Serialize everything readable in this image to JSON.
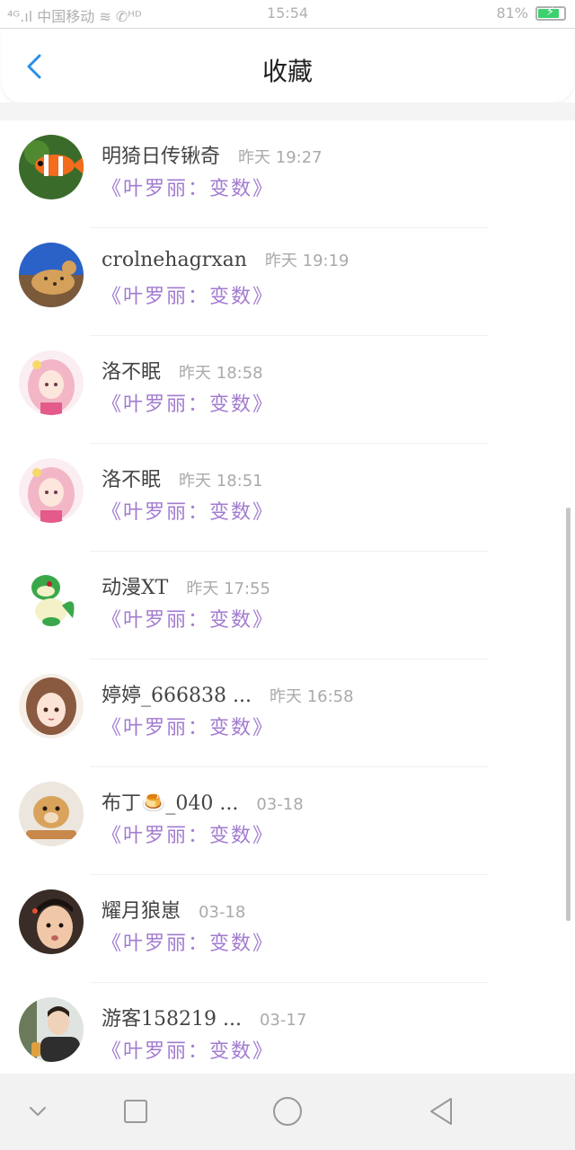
{
  "status_bar": {
    "left": "⁴ᴳ.ıl 中国移动 ≋ ✆ᴴᴰ",
    "time": "15:54",
    "battery": "81%"
  },
  "header": {
    "title": "收藏"
  },
  "items": [
    {
      "name": "明猗日传锹奇",
      "time": "昨天 19:27",
      "work": "《叶罗丽：变数》",
      "avatar": "clownfish"
    },
    {
      "name": "crolnehagrxan",
      "time": "昨天 19:19",
      "work": "《叶罗丽：变数》",
      "avatar": "leopard"
    },
    {
      "name": "洛不眠",
      "time": "昨天 18:58",
      "work": "《叶罗丽：变数》",
      "avatar": "anime-girl-pink"
    },
    {
      "name": "洛不眠",
      "time": "昨天 18:51",
      "work": "《叶罗丽：变数》",
      "avatar": "anime-girl-pink"
    },
    {
      "name": "动漫XT",
      "time": "昨天 17:55",
      "work": "《叶罗丽：变数》",
      "avatar": "snivy"
    },
    {
      "name": "婷婷_666838 ...",
      "time": "昨天 16:58",
      "work": "《叶罗丽：变数》",
      "avatar": "anime-girl-brown"
    },
    {
      "name": "布丁🍮_040 ...",
      "time": "03-18",
      "work": "《叶罗丽：变数》",
      "avatar": "dog"
    },
    {
      "name": "耀月狼崽",
      "time": "03-18",
      "work": "《叶罗丽：变数》",
      "avatar": "boy-photo"
    },
    {
      "name": "游客158219 ...",
      "time": "03-17",
      "work": "《叶罗丽：变数》",
      "avatar": "person-photo"
    }
  ],
  "colors": {
    "accent": "#2a8fe8",
    "work_title": "#a27bd0",
    "battery": "#3cd070"
  }
}
